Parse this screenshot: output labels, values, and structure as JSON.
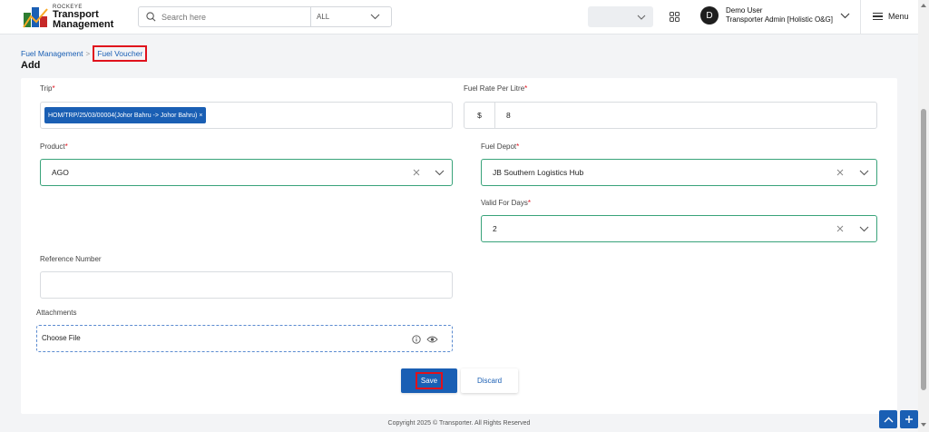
{
  "header": {
    "logo_small": "ROCKEYE",
    "logo_line1": "Transport",
    "logo_line2": "Management",
    "search_placeholder": "Search here",
    "search_scope": "ALL",
    "user_initial": "D",
    "user_name": "Demo User",
    "user_role": "Transporter Admin [Holistic O&G]",
    "menu_label": "Menu"
  },
  "breadcrumb": {
    "parent": "Fuel Management",
    "separator": ">",
    "current": "Fuel Voucher"
  },
  "page": {
    "title": "Add"
  },
  "form": {
    "trip": {
      "label": "Trip",
      "required": "*",
      "tag": "HOM/TRP/25/03/00004(Johor Bahru -> Johor Bahru) ×"
    },
    "fuel_rate": {
      "label": "Fuel Rate Per Litre",
      "required": "*",
      "prefix": "$",
      "value": "8"
    },
    "product": {
      "label": "Product",
      "required": "*",
      "value": "AGO"
    },
    "fuel_depot": {
      "label": "Fuel Depot",
      "required": "*",
      "value": "JB Southern Logistics Hub"
    },
    "valid_days": {
      "label": "Valid For Days",
      "required": "*",
      "value": "2"
    },
    "reference": {
      "label": "Reference Number",
      "value": ""
    },
    "attachments": {
      "label": "Attachments",
      "placeholder": "Choose File"
    }
  },
  "actions": {
    "save": "Save",
    "discard": "Discard"
  },
  "footer": {
    "text": "Copyright 2025 © Transporter. All Rights Reserved"
  },
  "colors": {
    "primary": "#1a5fb4",
    "focus_border": "#39a37a",
    "highlight": "#e0111c"
  }
}
